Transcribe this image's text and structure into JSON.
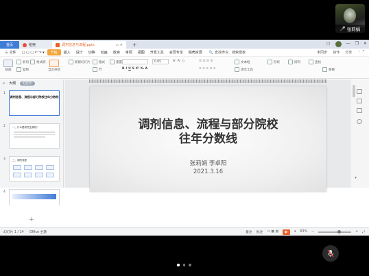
{
  "participant": {
    "name": "张莉娟"
  },
  "tabs": [
    {
      "label": "首页"
    },
    {
      "label": "稻壳"
    },
    {
      "label": "调剂信息与流程.pptx"
    }
  ],
  "menu": {
    "file": "三 文件",
    "items": [
      "开始",
      "插入",
      "设计",
      "切换",
      "动画",
      "放映",
      "审阅",
      "视图",
      "开发工具",
      "会员专享",
      "稻壳资源"
    ],
    "search": "查找命令、搜索模板",
    "right": [
      "未同步",
      "协作",
      "分享"
    ]
  },
  "toolbar": {
    "paste": "粘贴",
    "cut": "剪切",
    "copy": "复制",
    "format_painter": "格式刷",
    "from_current": "当页开始",
    "new_slide": "新建幻灯片",
    "layout": "版式",
    "section": "节",
    "reset": "重置",
    "font_size": "0.05",
    "textbox": "文本框",
    "shape": "形状",
    "arrange": "排列",
    "find": "查找",
    "replace": "替换",
    "pic_fill": "演示工具"
  },
  "left_panel": {
    "tab_outline": "大纲",
    "tab_slides": "幻灯片",
    "slides": [
      {
        "num": "1",
        "title": "调剂信息、流程与部分院校往年分数线"
      },
      {
        "num": "2",
        "title": "一、什么是研究生调剂？"
      },
      {
        "num": "3",
        "title": "二、调剂流程"
      },
      {
        "num": "4",
        "title": ""
      }
    ]
  },
  "slide": {
    "title_line1": "调剂信息、流程与部分院校",
    "title_line2": "往年分数线",
    "authors": "张莉娟 李卓阳",
    "date": "2021.3.16"
  },
  "status": {
    "slide_counter": "幻灯片 1 / 14",
    "theme": "Office 主题",
    "notes": "备注",
    "comments": "批注",
    "zoom": "63%"
  },
  "colors": {
    "accent": "#3f7cd6",
    "start_tab": "#f3a53a",
    "play": "#e8622e"
  }
}
